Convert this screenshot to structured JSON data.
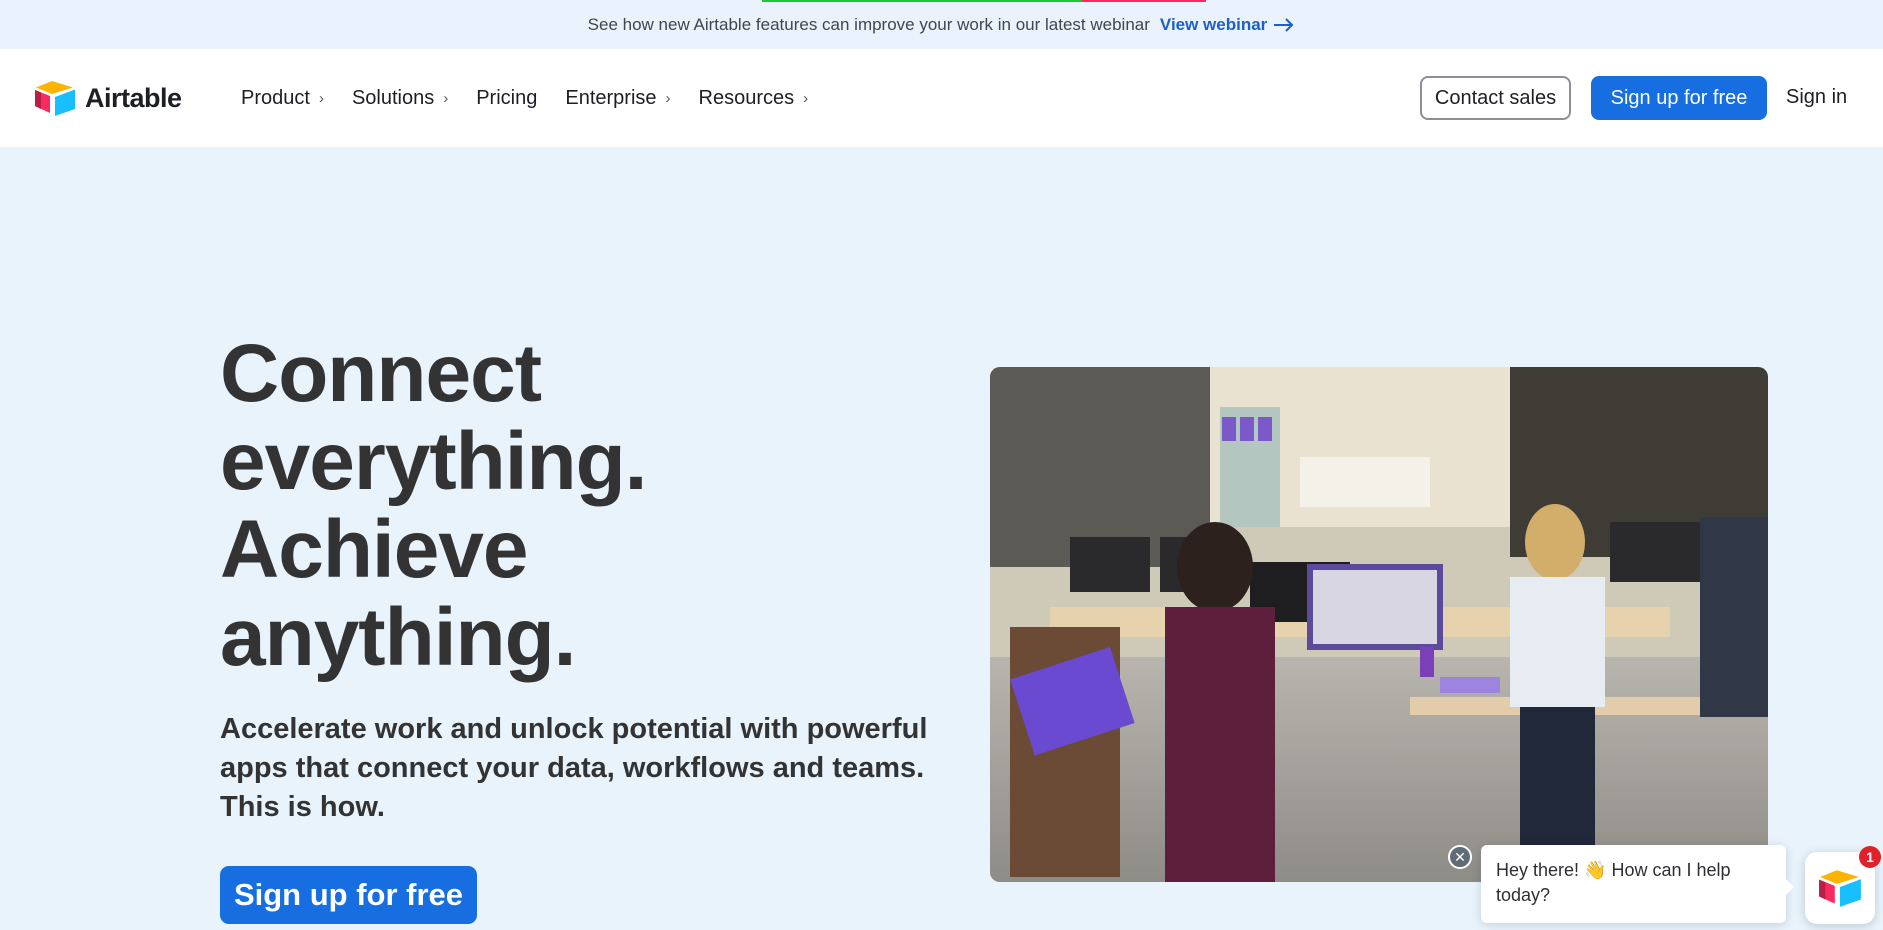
{
  "announcement": {
    "text": "See how new Airtable features can improve your work in our latest webinar",
    "link_label": "View webinar",
    "link_icon": "arrow-right-icon"
  },
  "brand": {
    "name": "Airtable",
    "logo_icon": "airtable-logo-icon"
  },
  "nav": {
    "items": [
      {
        "label": "Product",
        "has_submenu": true
      },
      {
        "label": "Solutions",
        "has_submenu": true
      },
      {
        "label": "Pricing",
        "has_submenu": false
      },
      {
        "label": "Enterprise",
        "has_submenu": true
      },
      {
        "label": "Resources",
        "has_submenu": true
      }
    ],
    "contact_sales": "Contact sales",
    "sign_up": "Sign up for free",
    "sign_in": "Sign in"
  },
  "hero": {
    "title_lines": [
      "Connect",
      "everything.",
      "Achieve",
      "anything."
    ],
    "subtitle": "Accelerate work and unlock potential with powerful apps that connect your data, workflows and teams. This is how.",
    "cta": "Sign up for free"
  },
  "chat": {
    "message_prefix": "Hey there!",
    "emoji": "👋",
    "message_suffix": "How can I help today?",
    "badge_count": "1",
    "close_icon": "close-icon",
    "launcher_icon": "airtable-logo-icon"
  },
  "colors": {
    "accent": "#166ee1",
    "page_bg": "#e8f3fc",
    "heading": "#333333",
    "link": "#1d5fc6",
    "badge": "#e0202a"
  }
}
